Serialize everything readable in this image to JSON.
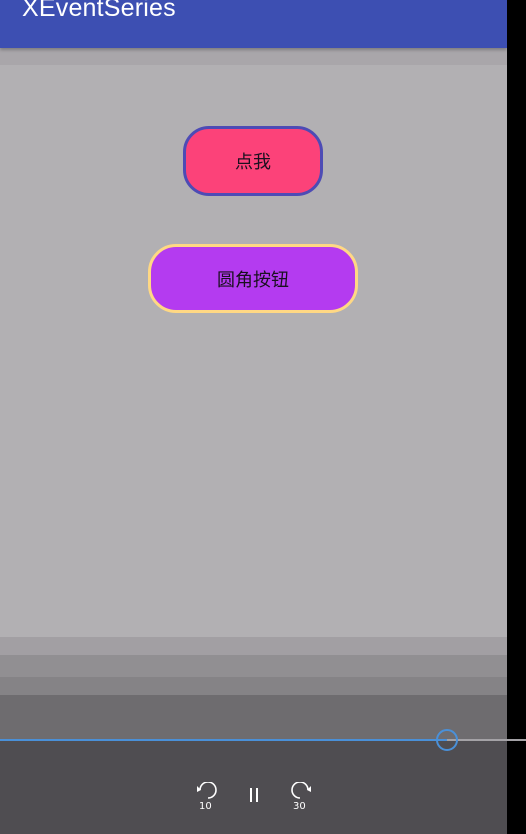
{
  "app_bar": {
    "title": "XEventSeries",
    "color": "#3d4fb2"
  },
  "buttons": {
    "click_me": {
      "label": "点我",
      "fill": "#fc4279",
      "border": "#4d4bb5"
    },
    "rounded": {
      "label": "圆角按钮",
      "fill": "#b43bf0",
      "border": "#ffd884"
    }
  },
  "media_controls": {
    "skip_back_seconds": "10",
    "skip_forward_seconds": "30",
    "playback_progress": 0.85,
    "accent_color": "#4a90d8",
    "icons": [
      "skip-back-10-icon",
      "pause-icon",
      "skip-forward-30-icon"
    ]
  }
}
